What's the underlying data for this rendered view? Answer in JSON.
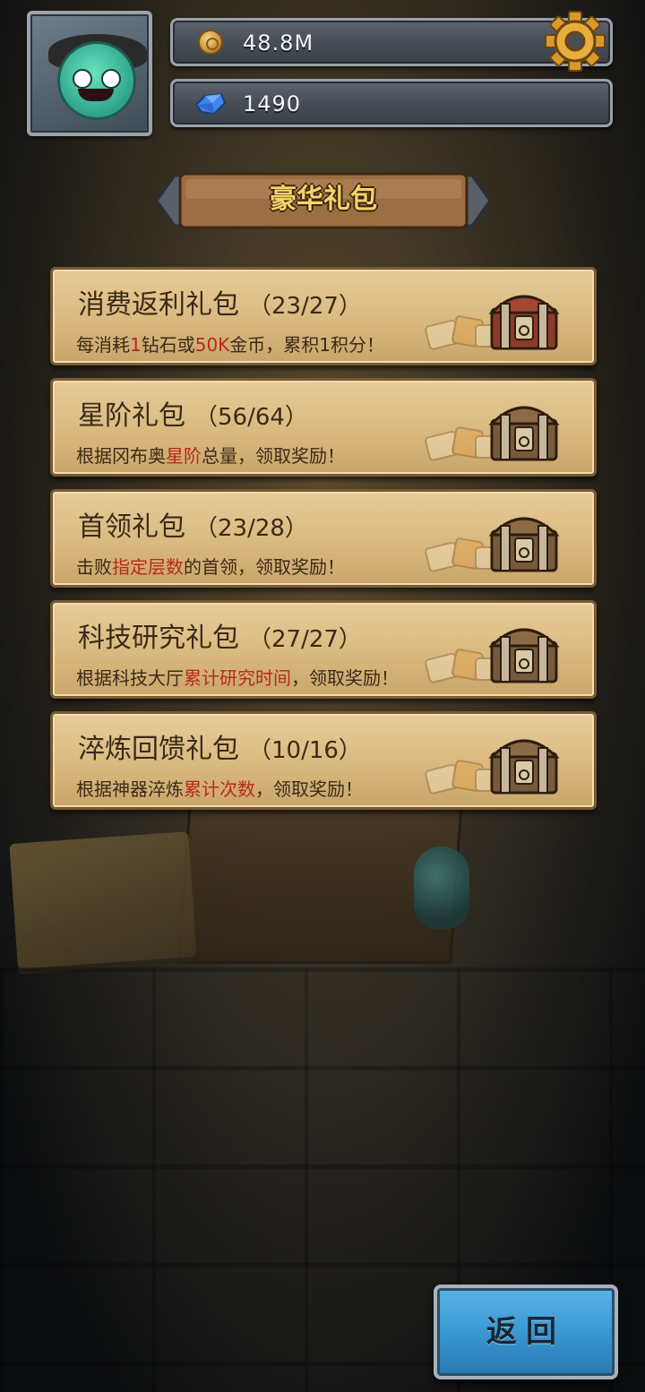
{
  "header": {
    "gold_value": "48.8M",
    "gem_value": "1490"
  },
  "title": "豪华礼包",
  "packages": [
    {
      "name": "消费返利礼包",
      "progress": "（23/27）",
      "desc": [
        {
          "t": "每消耗"
        },
        {
          "t": "1",
          "hl": true
        },
        {
          "t": "钻石或"
        },
        {
          "t": "50K",
          "hl": true
        },
        {
          "t": "金币，累积1积分！"
        }
      ],
      "chest": "ornate-red-chest-icon"
    },
    {
      "name": "星阶礼包",
      "progress": "（56/64）",
      "desc": [
        {
          "t": "根据冈布奥"
        },
        {
          "t": "星阶",
          "hl": true
        },
        {
          "t": "总量，领取奖励！"
        }
      ],
      "chest": "wooden-chest-icon"
    },
    {
      "name": "首领礼包",
      "progress": "（23/28）",
      "desc": [
        {
          "t": "击败"
        },
        {
          "t": "指定层数",
          "hl": true
        },
        {
          "t": "的首领，领取奖励！"
        }
      ],
      "chest": "wooden-chest-icon"
    },
    {
      "name": "科技研究礼包",
      "progress": "（27/27）",
      "desc": [
        {
          "t": "根据科技大厅"
        },
        {
          "t": "累计研究时间",
          "hl": true
        },
        {
          "t": "，领取奖励！"
        }
      ],
      "chest": "wooden-chest-icon"
    },
    {
      "name": "淬炼回馈礼包",
      "progress": "（10/16）",
      "desc": [
        {
          "t": "根据神器淬炼"
        },
        {
          "t": "累计次数",
          "hl": true
        },
        {
          "t": "，领取奖励！"
        }
      ],
      "chest": "wooden-chest-icon"
    }
  ],
  "back_button": {
    "label": "返回"
  },
  "colors": {
    "highlight": "#b8291c",
    "card": "#d9b97f",
    "title": "#f4d36a",
    "back": "#3795cf"
  }
}
